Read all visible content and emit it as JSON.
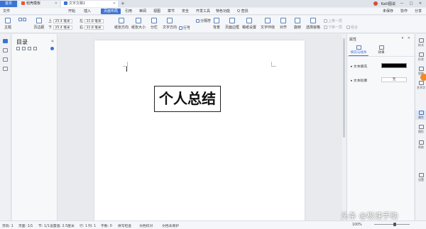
{
  "titlebar": {
    "tabs": [
      {
        "label": "首页"
      },
      {
        "label": "稻壳模板"
      },
      {
        "label": "文字文稿1"
      }
    ],
    "new_tab": "+",
    "user_name": "Kalil图说",
    "win_min": "—",
    "win_max": "□",
    "win_close": "✕"
  },
  "menubar": {
    "file": "文件",
    "items": [
      "开始",
      "插入",
      "页面布局",
      "引用",
      "审阅",
      "视图",
      "章节",
      "安全",
      "开发工具",
      "特色功能"
    ],
    "active": "页面布局",
    "search": "Q 查找",
    "right": [
      "未保存",
      "协作",
      "分享"
    ]
  },
  "ribbon": {
    "theme": "主题",
    "margins": "页边距",
    "top_label": "上",
    "top_value": "25.4 毫米",
    "bottom_label": "下",
    "bottom_value": "25.4 毫米",
    "left_label": "左",
    "left_value": "31.8 毫米",
    "right_label": "右",
    "right_value": "31.8 毫米",
    "orientation": "纸张方向",
    "size": "纸张大小",
    "columns": "分栏",
    "text_direction": "文字方向",
    "line_numbers": "行号",
    "breaks": "分隔符",
    "background": "背景",
    "borders": "页面边框",
    "watermark": "稿纸设置",
    "wrap": "文字环绕",
    "align": "对齐",
    "rotate": "旋转",
    "select": "选择窗格",
    "up": "上移一层",
    "down": "下移一层",
    "group": "组合"
  },
  "outline": {
    "title": "目录",
    "close": "«"
  },
  "document": {
    "heading": "个人总结"
  },
  "properties": {
    "title": "属性",
    "controls": "▾ ✕",
    "tabs": [
      {
        "label": "填充与线条"
      },
      {
        "label": "效果"
      }
    ],
    "fill_label": "▸ 文本填充",
    "fill_color": "#000000",
    "line_label": "▸ 文本轮廓",
    "line_value": "无"
  },
  "rightstrip": {
    "items": [
      "样式",
      "形状",
      "智能",
      "艺术字",
      "属性",
      "图形",
      "帮助",
      "设置"
    ]
  },
  "statusbar": {
    "page": "页码: 1",
    "pages": "页面: 1/1",
    "section": "节: 1/1",
    "setting": "设置值: 2.5厘米",
    "row": "行: 1",
    "col": "列: 1",
    "words": "字数: 0",
    "spell": "拼写检查",
    "proof": "文档校对",
    "protect": "文档未保护",
    "zoom": "100%"
  },
  "zoom_level": 1.0,
  "overlay": {
    "watermark": "头条 @极速手助"
  }
}
